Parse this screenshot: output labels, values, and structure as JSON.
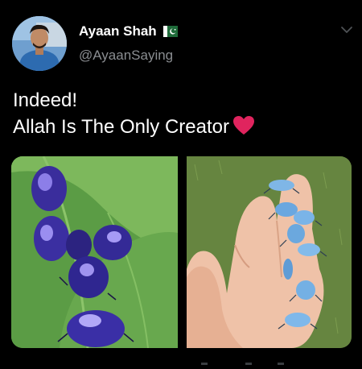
{
  "tweet": {
    "author": {
      "display_name": "Ayaan Shah",
      "handle": "@AyaanSaying",
      "flag_icon": "pakistan-flag-icon",
      "avatar_alt": "profile photo"
    },
    "menu_icon": "chevron-down-icon",
    "text": {
      "line1": "Indeed!",
      "line2": "Allah Is The Only Creator",
      "emoji": "red-heart-icon"
    },
    "media": [
      {
        "description_icon": "purple-beetles-on-leaf-photo"
      },
      {
        "description_icon": "blue-beetles-on-hand-photo"
      }
    ]
  },
  "colors": {
    "background": "#000000",
    "text_primary": "#ffffff",
    "text_secondary": "#8a8d91",
    "heart": "#e0245e"
  }
}
